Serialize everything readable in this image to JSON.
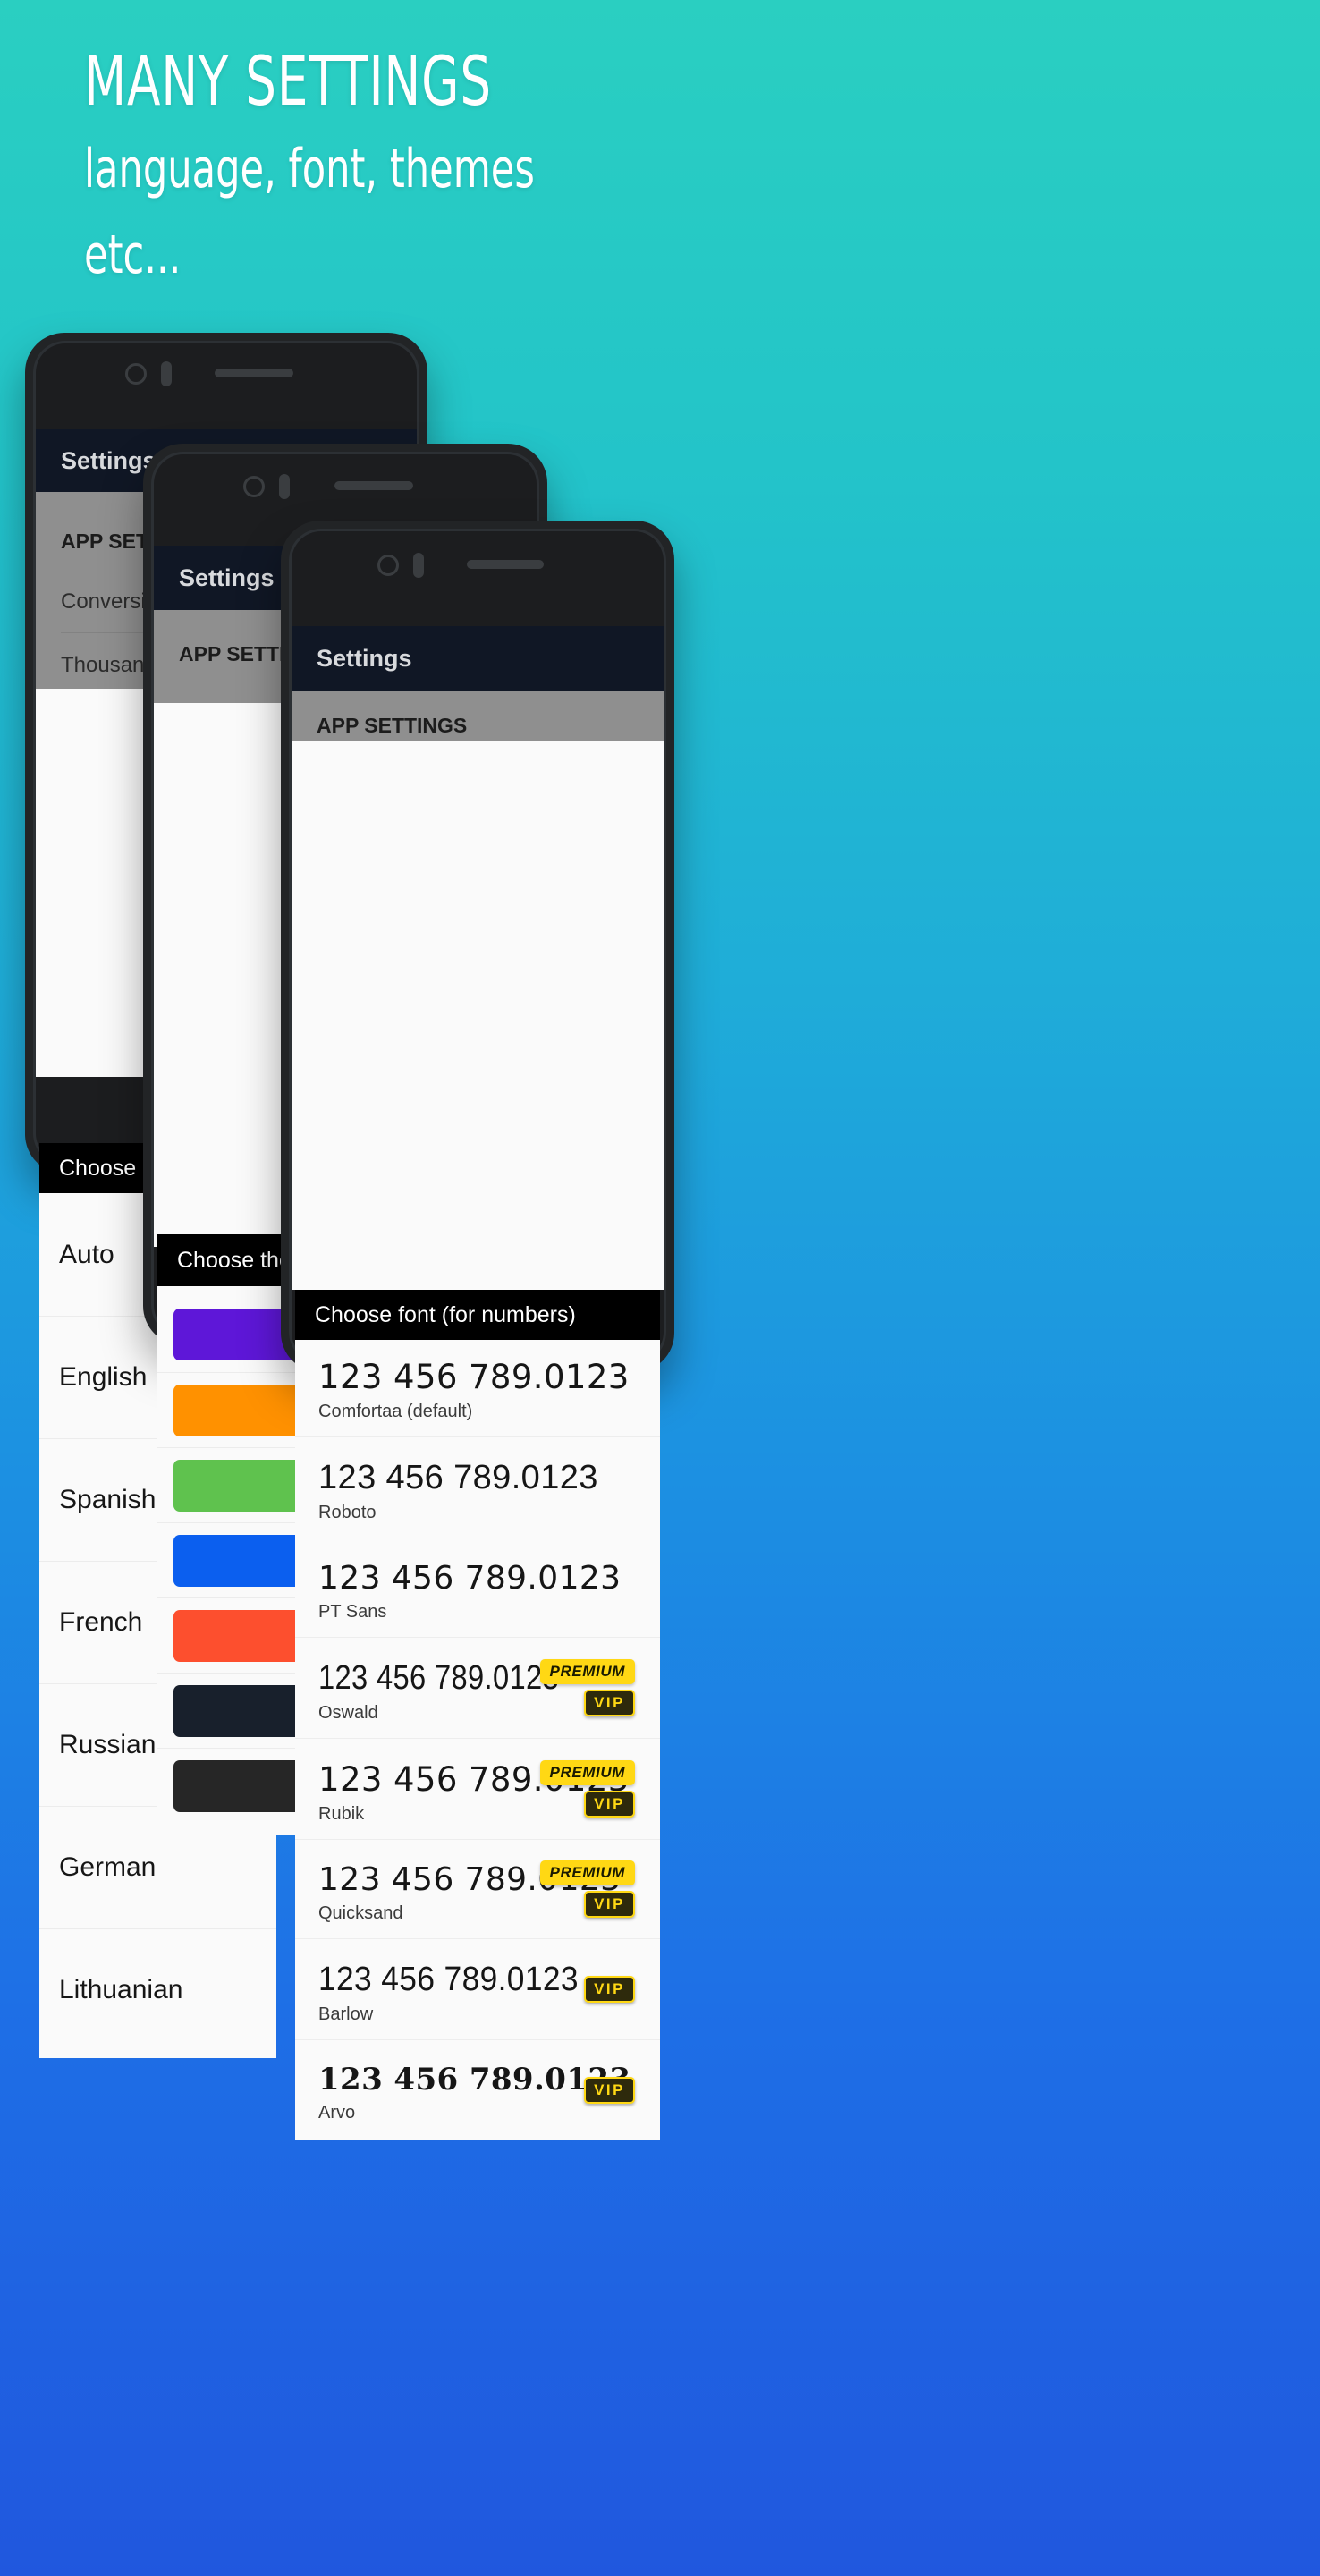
{
  "headline": {
    "line1": "MANY SETTINGS",
    "line2": "language, font, themes",
    "line3": "etc..."
  },
  "colors": {
    "bg_top": "#2ACFC1",
    "bg_bottom": "#2057DE",
    "appbar": "#101725",
    "dialog_header": "#000000",
    "badge_premium_bg": "#FFD814",
    "badge_vip_bg": "#2E2A0C",
    "badge_vip_text": "#FFD814"
  },
  "phone_left": {
    "appbar_title": "Settings",
    "section_header": "APP SETTINGS",
    "rows": [
      "Conversion",
      "Thousand s"
    ],
    "dialog": {
      "title": "Choose app language",
      "options": [
        "Auto",
        "English",
        "Spanish",
        "French",
        "Russian",
        "German",
        "Lithuanian"
      ]
    }
  },
  "phone_mid": {
    "appbar_title": "Settings",
    "section_header": "APP SETTINGS",
    "dialog": {
      "title": "Choose theme",
      "swatches": [
        {
          "name": "purple",
          "color": "#5E17D8"
        },
        {
          "name": "orange",
          "color": "#FF9100"
        },
        {
          "name": "green",
          "color": "#5FC24E"
        },
        {
          "name": "blue",
          "color": "#0B5FEF"
        },
        {
          "name": "red-orange",
          "color": "#FD4F2E"
        },
        {
          "name": "navy",
          "color": "#18202C"
        },
        {
          "name": "charcoal",
          "color": "#262626"
        }
      ]
    }
  },
  "phone_right": {
    "appbar_title": "Settings",
    "section_header": "APP SETTINGS",
    "dialog": {
      "title": "Choose font (for numbers)",
      "sample": "123 456 789.0123",
      "badge_premium_label": "PREMIUM",
      "badge_vip_label": "VIP",
      "fonts": [
        {
          "name": "Comfortaa (default)",
          "css": "ff-comfortaa",
          "premium": false,
          "vip": false
        },
        {
          "name": "Roboto",
          "css": "ff-roboto",
          "premium": false,
          "vip": false
        },
        {
          "name": "PT Sans",
          "css": "ff-ptsans",
          "premium": false,
          "vip": false
        },
        {
          "name": "Oswald",
          "css": "ff-oswald",
          "premium": true,
          "vip": true
        },
        {
          "name": "Rubik",
          "css": "ff-rubik",
          "premium": true,
          "vip": true
        },
        {
          "name": "Quicksand",
          "css": "ff-quicksand",
          "premium": true,
          "vip": true
        },
        {
          "name": "Barlow",
          "css": "ff-barlow",
          "premium": false,
          "vip": true
        },
        {
          "name": "Arvo",
          "css": "ff-arvo",
          "premium": false,
          "vip": true
        }
      ]
    }
  }
}
